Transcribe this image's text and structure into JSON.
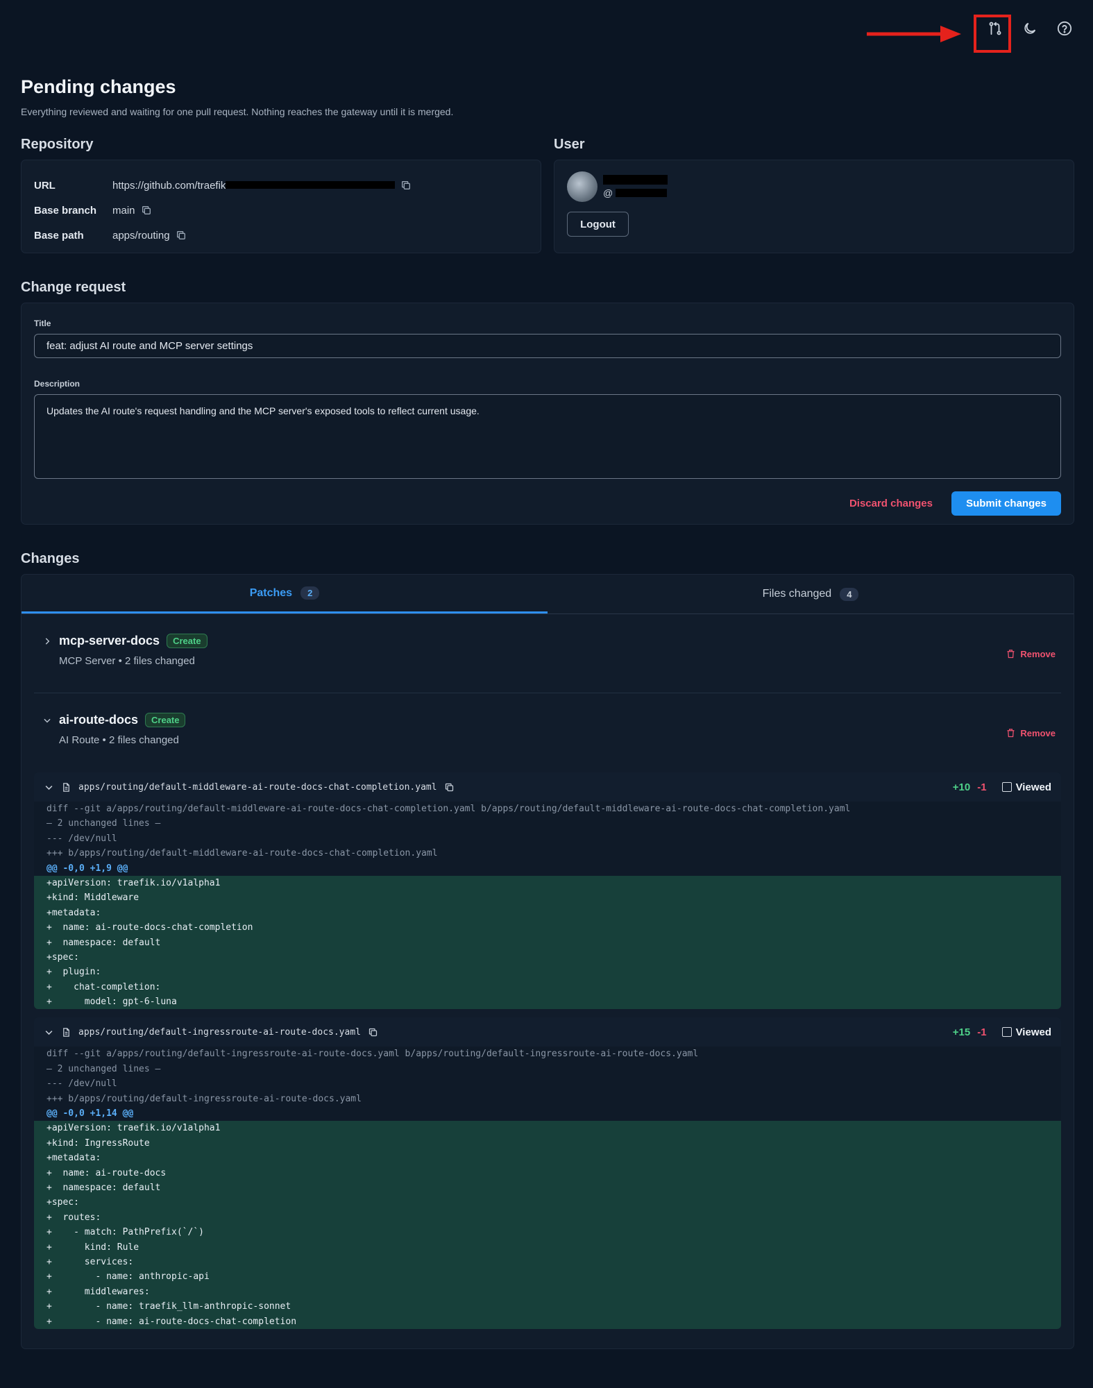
{
  "annotations": {
    "accent_red": "#e5221c"
  },
  "topbar": {
    "icons": [
      "git-pull-request-icon",
      "moon-icon",
      "help-icon"
    ]
  },
  "page": {
    "title": "Pending changes",
    "subtitle": "Everything reviewed and waiting for one pull request. Nothing reaches the gateway until it is merged."
  },
  "repository": {
    "heading": "Repository",
    "url_label": "URL",
    "url_value": "https://github.com/traefik",
    "branch_label": "Base branch",
    "branch_value": "main",
    "path_label": "Base path",
    "path_value": "apps/routing"
  },
  "user": {
    "heading": "User",
    "handle_prefix": "@",
    "logout_label": "Logout"
  },
  "change_request": {
    "heading": "Change request",
    "title_label": "Title",
    "title_value": "feat: adjust AI route and MCP server settings",
    "description_label": "Description",
    "description_value": "Updates the AI route's request handling and the MCP server's exposed tools to reflect current usage.",
    "discard_label": "Discard changes",
    "submit_label": "Submit changes"
  },
  "changes": {
    "heading": "Changes",
    "tabs": [
      {
        "label": "Patches",
        "count": "2"
      },
      {
        "label": "Files changed",
        "count": "4"
      }
    ],
    "patches": [
      {
        "name": "mcp-server-docs",
        "badge": "Create",
        "meta": "MCP Server • 2 files changed",
        "remove": "Remove"
      },
      {
        "name": "ai-route-docs",
        "badge": "Create",
        "meta": "AI Route • 2 files changed",
        "remove": "Remove"
      }
    ],
    "diffs": [
      {
        "file": "apps/routing/default-middleware-ai-route-docs-chat-completion.yaml",
        "additions": "+10",
        "deletions": "-1",
        "viewed_label": "Viewed",
        "lines": [
          {
            "type": "meta",
            "text": "diff --git a/apps/routing/default-middleware-ai-route-docs-chat-completion.yaml b/apps/routing/default-middleware-ai-route-docs-chat-completion.yaml"
          },
          {
            "type": "meta",
            "text": "— 2 unchanged lines —"
          },
          {
            "type": "meta",
            "text": "--- /dev/null"
          },
          {
            "type": "meta",
            "text": "+++ b/apps/routing/default-middleware-ai-route-docs-chat-completion.yaml"
          },
          {
            "type": "hunk",
            "text": "@@ -0,0 +1,9 @@"
          },
          {
            "type": "plus",
            "text": "+apiVersion: traefik.io/v1alpha1"
          },
          {
            "type": "plus",
            "text": "+kind: Middleware"
          },
          {
            "type": "plus",
            "text": "+metadata:"
          },
          {
            "type": "plus",
            "text": "+  name: ai-route-docs-chat-completion"
          },
          {
            "type": "plus",
            "text": "+  namespace: default"
          },
          {
            "type": "plus",
            "text": "+spec:"
          },
          {
            "type": "plus",
            "text": "+  plugin:"
          },
          {
            "type": "plus",
            "text": "+    chat-completion:"
          },
          {
            "type": "plus",
            "text": "+      model: gpt-6-luna"
          }
        ]
      },
      {
        "file": "apps/routing/default-ingressroute-ai-route-docs.yaml",
        "additions": "+15",
        "deletions": "-1",
        "viewed_label": "Viewed",
        "lines": [
          {
            "type": "meta",
            "text": "diff --git a/apps/routing/default-ingressroute-ai-route-docs.yaml b/apps/routing/default-ingressroute-ai-route-docs.yaml"
          },
          {
            "type": "meta",
            "text": "— 2 unchanged lines —"
          },
          {
            "type": "meta",
            "text": "--- /dev/null"
          },
          {
            "type": "meta",
            "text": "+++ b/apps/routing/default-ingressroute-ai-route-docs.yaml"
          },
          {
            "type": "hunk",
            "text": "@@ -0,0 +1,14 @@"
          },
          {
            "type": "plus",
            "text": "+apiVersion: traefik.io/v1alpha1"
          },
          {
            "type": "plus",
            "text": "+kind: IngressRoute"
          },
          {
            "type": "plus",
            "text": "+metadata:"
          },
          {
            "type": "plus",
            "text": "+  name: ai-route-docs"
          },
          {
            "type": "plus",
            "text": "+  namespace: default"
          },
          {
            "type": "plus",
            "text": "+spec:"
          },
          {
            "type": "plus",
            "text": "+  routes:"
          },
          {
            "type": "plus",
            "text": "+    - match: PathPrefix(`/`)"
          },
          {
            "type": "plus",
            "text": "+      kind: Rule"
          },
          {
            "type": "plus",
            "text": "+      services:"
          },
          {
            "type": "plus",
            "text": "+        - name: anthropic-api"
          },
          {
            "type": "plus",
            "text": "+      middlewares:"
          },
          {
            "type": "plus",
            "text": "+        - name: traefik_llm-anthropic-sonnet"
          },
          {
            "type": "plus",
            "text": "+        - name: ai-route-docs-chat-completion"
          }
        ]
      }
    ]
  }
}
